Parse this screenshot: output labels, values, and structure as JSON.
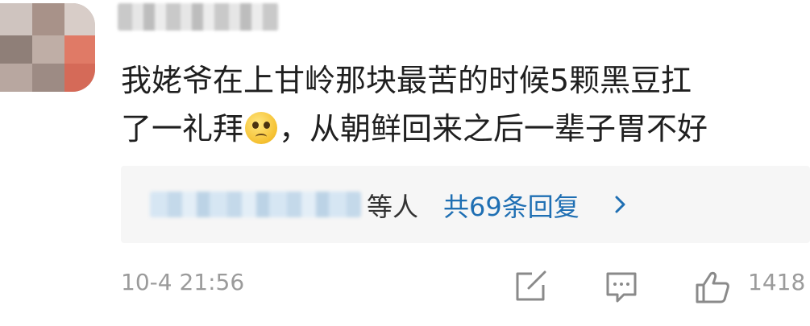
{
  "comment": {
    "line1": "我姥爷在上甘岭那块最苦的时候5颗黑豆扛",
    "line2a": "了一礼拜",
    "line2b": "，从朝鲜回来之后一辈子胃不好"
  },
  "replies": {
    "suffix": "等人",
    "count_label": "共69条回复"
  },
  "footer": {
    "timestamp": "10-4 21:56",
    "like_count": "1418"
  },
  "icons": [
    "pleading-face-emoji",
    "chevron-right-icon",
    "share-icon",
    "comment-icon",
    "thumbs-up-icon"
  ],
  "colors": {
    "link": "#1f6fb3",
    "muted": "#9b9b9b",
    "reply_bg": "#f6f6f6"
  }
}
